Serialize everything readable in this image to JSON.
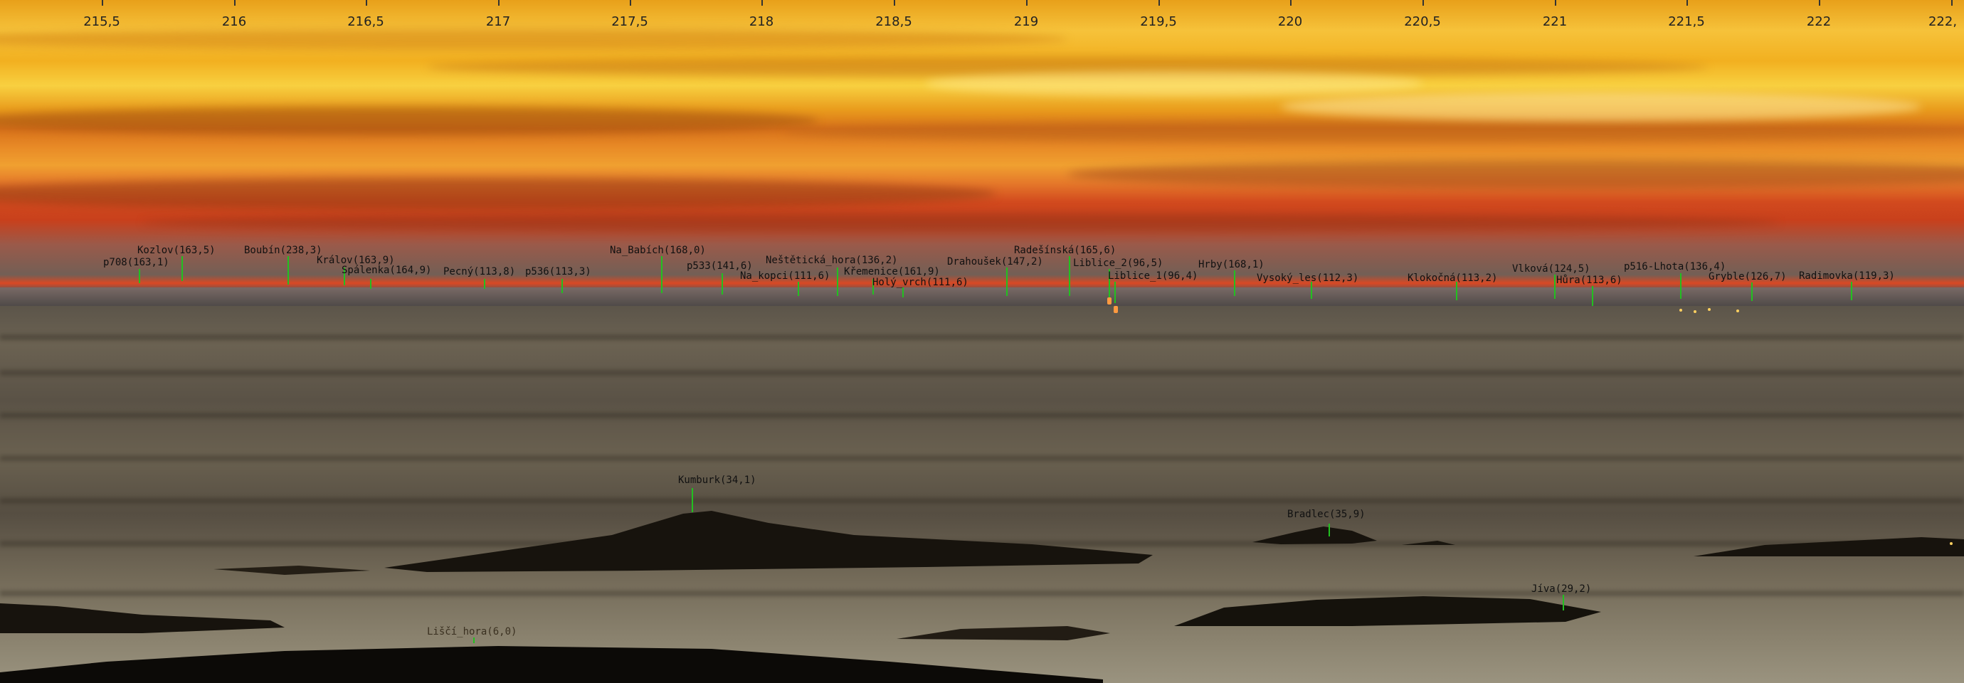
{
  "axis": {
    "ticks": [
      "215,5",
      "216",
      "216,5",
      "217",
      "217,5",
      "218",
      "218,5",
      "219",
      "219,5",
      "220",
      "220,5",
      "221",
      "221,5",
      "222",
      "222,"
    ]
  },
  "peaks": [
    {
      "label": "p708(163,1)"
    },
    {
      "label": "Kozlov(163,5)"
    },
    {
      "label": "Boubín(238,3)"
    },
    {
      "label": "Králov(163,9)"
    },
    {
      "label": "Spálenka(164,9)"
    },
    {
      "label": "Pecný(113,8)"
    },
    {
      "label": "p536(113,3)"
    },
    {
      "label": "Na_Babích(168,0)"
    },
    {
      "label": "p533(141,6)"
    },
    {
      "label": "Na_kopci(111,6)"
    },
    {
      "label": "Neštětická_hora(136,2)"
    },
    {
      "label": "Křemenice(161,9)"
    },
    {
      "label": "Holý_vrch(111,6)"
    },
    {
      "label": "Drahoušek(147,2)"
    },
    {
      "label": "Radešínská(165,6)"
    },
    {
      "label": "Liblice_2(96,5)"
    },
    {
      "label": "Liblice_1(96,4)"
    },
    {
      "label": "Hrby(168,1)"
    },
    {
      "label": "Vysoký_les(112,3)"
    },
    {
      "label": "Klokočná(113,2)"
    },
    {
      "label": "Vlková(124,5)"
    },
    {
      "label": "Hůra(113,6)"
    },
    {
      "label": "p516-Lhota(136,4)"
    },
    {
      "label": "Gryble(126,7)"
    },
    {
      "label": "Radimovka(119,3)"
    },
    {
      "label": "Kumburk(34,1)"
    },
    {
      "label": "Bradlec(35,9)"
    },
    {
      "label": "Jíva(29,2)"
    },
    {
      "label": "Liščí_hora(6,0)"
    }
  ]
}
